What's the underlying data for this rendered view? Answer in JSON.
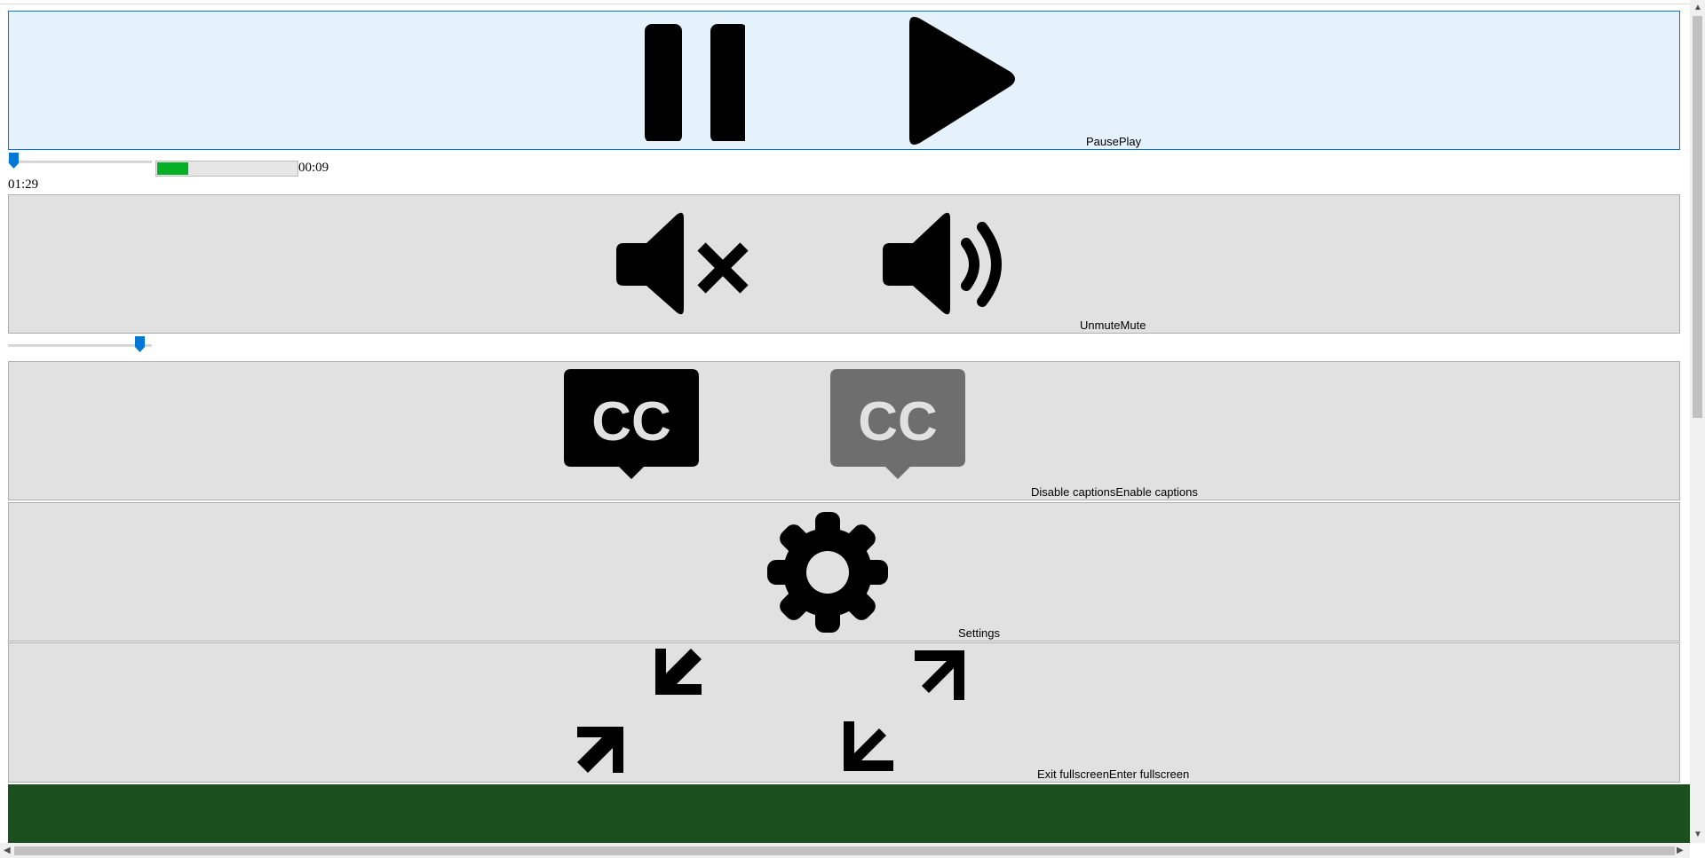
{
  "play_button": {
    "label": "PausePlay",
    "pause_icon": "pause-icon",
    "play_icon": "play-icon"
  },
  "seek": {
    "position": 0.0,
    "progress_percent": 22,
    "buffered_label": "00:09",
    "current_time": "01:29"
  },
  "mute_button": {
    "label": "UnmuteMute",
    "unmute_icon": "speaker-muted-icon",
    "mute_icon": "speaker-volume-icon"
  },
  "volume": {
    "level": 0.95
  },
  "captions_button": {
    "label": "Disable captionsEnable captions",
    "on_icon": "captions-on-icon",
    "off_icon": "captions-off-icon"
  },
  "settings_button": {
    "label": "Settings",
    "icon": "gear-icon"
  },
  "fullscreen_button": {
    "label": "Exit fullscreenEnter fullscreen",
    "exit_icon": "exit-fullscreen-icon",
    "enter_icon": "enter-fullscreen-icon"
  },
  "colors": {
    "accent": "#0078d7",
    "progress": "#06b025",
    "footer": "#1b4f1e",
    "captions_off": "#6e6e6e"
  }
}
